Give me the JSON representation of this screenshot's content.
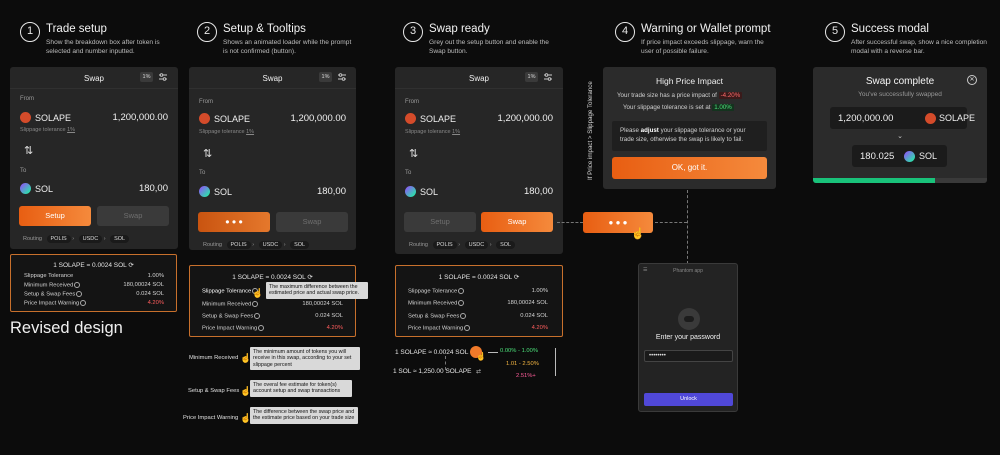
{
  "steps": [
    {
      "num": "1",
      "title": "Trade setup",
      "desc": "Show the breakdown box after token is selected and number inputted."
    },
    {
      "num": "2",
      "title": "Setup & Tooltips",
      "desc": "Shows an animated loader while the prompt is not confirmed (button)."
    },
    {
      "num": "3",
      "title": "Swap ready",
      "desc": "Grey out the setup button and enable the Swap button."
    },
    {
      "num": "4",
      "title": "Warning or Wallet prompt",
      "desc": "If price impact exceeds slippage, warn the user of possible failure."
    },
    {
      "num": "5",
      "title": "Success modal",
      "desc": "After successful swap, show a nice completion modal with a reverse bar."
    }
  ],
  "swap": {
    "title": "Swap",
    "slippage_badge": "1%",
    "from_label": "From",
    "to_label": "To",
    "from_token": "SOLAPE",
    "from_amount": "1,200,000.00",
    "to_token": "SOL",
    "to_amount": "180,00",
    "slippage_link": "Slippage tolerance",
    "slippage_link_value": "1%",
    "setup_label": "Setup",
    "swap_label": "Swap",
    "loader": "● ● ●",
    "routing_label": "Routing",
    "route": [
      "POLIS",
      "USDC",
      "SOL"
    ]
  },
  "breakdown": {
    "rate": "1 SOLAPE = 0.0024 SOL",
    "rows": [
      {
        "label": "Slippage Tolerance",
        "value": "1.00%"
      },
      {
        "label": "Minimum Received",
        "value": "180,00024 SOL"
      },
      {
        "label": "Setup & Swap Fees",
        "value": "0.024 SOL"
      },
      {
        "label": "Price Impact Warning",
        "value": "4.20%"
      }
    ]
  },
  "revised_title": "Revised design",
  "tooltips": {
    "slippage": "The maximum difference between the estimated price and actual swap price.",
    "minimum_label": "Minimum Received",
    "minimum": "The minimum amount of tokens you will receive in this swap, according to your set slippage percent",
    "fees_label": "Setup & Swap Fees",
    "fees": "The overal fee estimate for token(s) account setup and swap transactions",
    "impact_label": "Price Impact Warning",
    "impact": "The difference between the swap price and the estimate price based on your trade size"
  },
  "rate_toggle": {
    "rate_a": "1 SOLAPE ≈ 0.0024 SOL",
    "rate_b": "1 SOL ≈ 1,250.00 SOLAPE",
    "ranges": [
      {
        "text": "0.00% - 1.00%",
        "color": "#4ce07a"
      },
      {
        "text": "1.01 - 2.50%",
        "color": "#f5b642"
      },
      {
        "text": "2.51%+",
        "color": "#ff5d9a"
      }
    ]
  },
  "warning": {
    "title": "High Price Impact",
    "line1": "Your trade size has a price impact of",
    "impact": "-4.20%",
    "line2": "Your slippage tolerance is set at",
    "slippage": "1.00%",
    "advice_pre": "Please ",
    "advice_bold": "adjust",
    "advice_post": " your slippage tolerance or your trade size, otherwise the swap is likely to fail.",
    "ok": "OK, got it."
  },
  "vertical_note": "If Price impact > Slippage Tolerance",
  "phantom": {
    "app": "Phantom app",
    "prompt": "Enter your password",
    "password": "••••••••",
    "unlock": "Unlock"
  },
  "success": {
    "title": "Swap complete",
    "subtitle": "You've successfully swapped",
    "from_amount": "1,200,000.00",
    "from_token": "SOLAPE",
    "to_amount": "180.025",
    "to_token": "SOL",
    "progress": 0.7
  },
  "colors": {
    "accent": "#f07a2a",
    "green": "#19c27a",
    "red": "#ff5d5d"
  }
}
